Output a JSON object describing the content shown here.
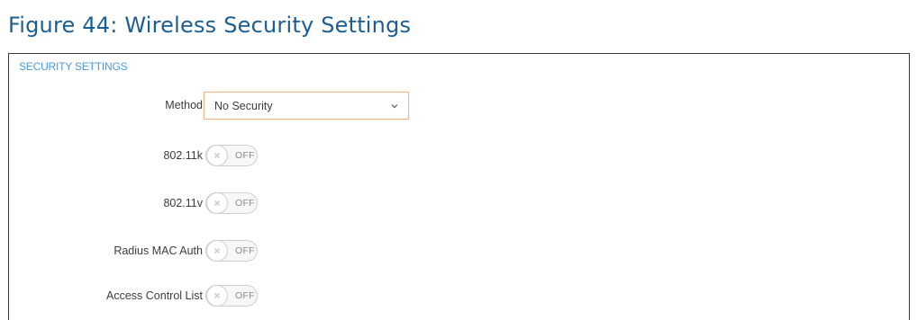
{
  "figure": {
    "caption": "Figure 44:  Wireless Security Settings"
  },
  "panel": {
    "title": "SECURITY SETTINGS",
    "method": {
      "label": "Method",
      "value": "No Security"
    },
    "toggles": [
      {
        "label": "802.11k",
        "state": "OFF"
      },
      {
        "label": "802.11v",
        "state": "OFF"
      },
      {
        "label": "Radius MAC Auth",
        "state": "OFF"
      },
      {
        "label": "Access Control List",
        "state": "OFF"
      }
    ]
  },
  "colors": {
    "caption": "#1b5f92",
    "panel_title": "#4a9bd6",
    "select_border": "#f1b58a"
  },
  "icons": {
    "select_arrow": "chevron-down-icon",
    "toggle_knob": "close-icon"
  }
}
